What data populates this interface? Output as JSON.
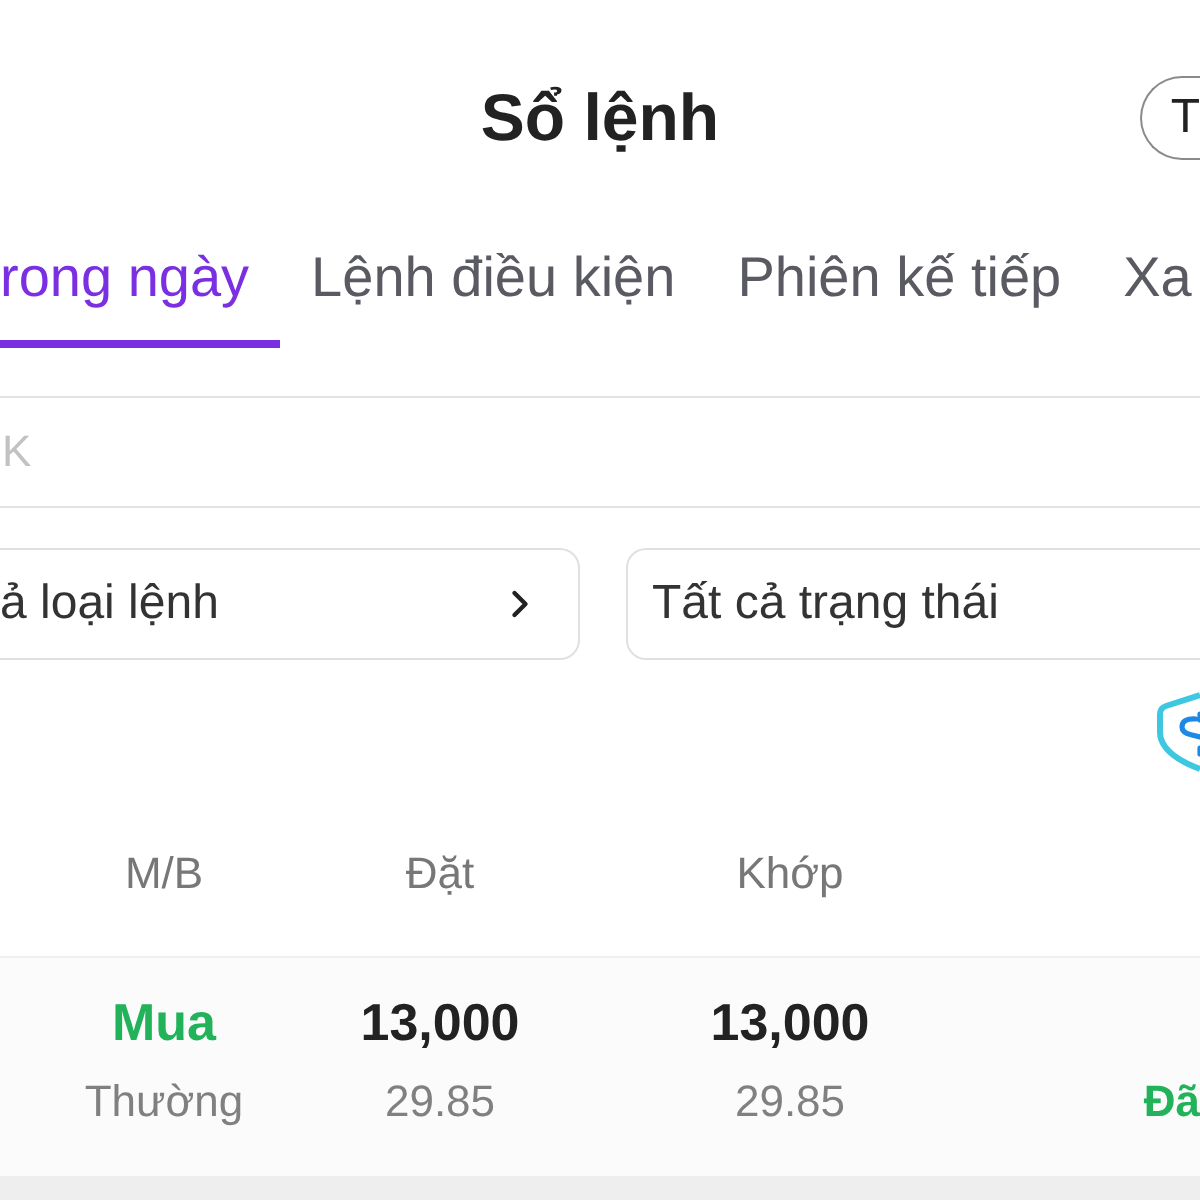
{
  "header": {
    "title": "Sổ lệnh",
    "action_button": "T"
  },
  "tabs": [
    {
      "label": "rong ngày",
      "selected": true
    },
    {
      "label": "Lệnh điều kiện",
      "selected": false
    },
    {
      "label": "Phiên kế tiếp",
      "selected": false
    },
    {
      "label": "Xa",
      "selected": false
    }
  ],
  "search": {
    "placeholder": "K"
  },
  "filters": [
    {
      "label": "ả loại lệnh",
      "kind": "chevron"
    },
    {
      "label": "Tất cả trạng thái",
      "kind": "plain"
    }
  ],
  "table": {
    "columns": [
      "M/B",
      "Đặt",
      "Khớp"
    ],
    "rows": [
      {
        "side": "Mua",
        "order_type": "Thường",
        "placed_qty": "13,000",
        "placed_price": "29.85",
        "matched_qty": "13,000",
        "matched_price": "29.85",
        "status": "Đã"
      }
    ]
  }
}
